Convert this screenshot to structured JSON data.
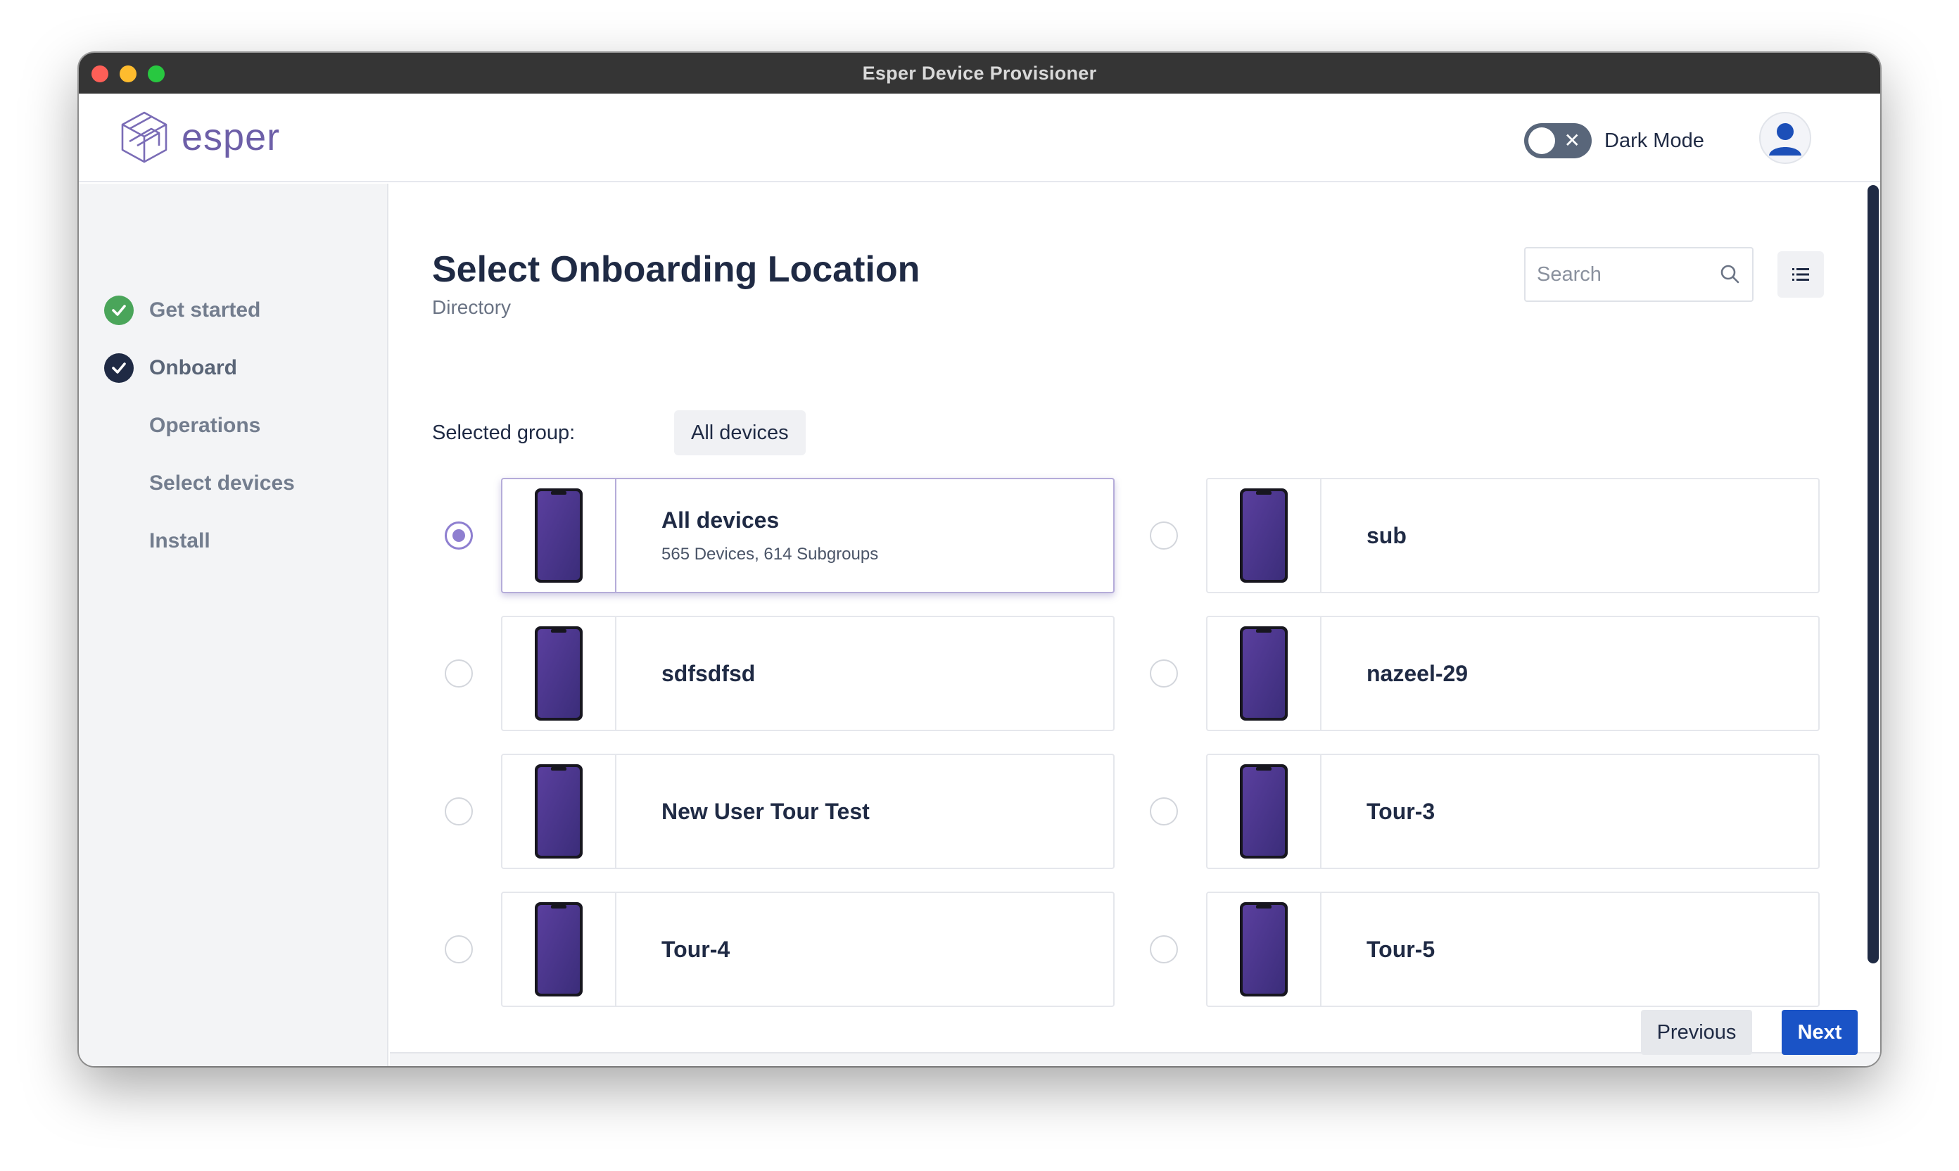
{
  "window": {
    "title": "Esper Device Provisioner"
  },
  "header": {
    "logo_text": "esper",
    "dark_mode_label": "Dark Mode",
    "dark_mode_on": false
  },
  "sidebar": {
    "steps": [
      {
        "label": "Get started",
        "status": "complete"
      },
      {
        "label": "Onboard",
        "status": "current"
      },
      {
        "label": "Operations",
        "status": "pending"
      },
      {
        "label": "Select devices",
        "status": "pending"
      },
      {
        "label": "Install",
        "status": "pending"
      }
    ]
  },
  "main": {
    "title": "Select Onboarding Location",
    "subtitle": "Directory",
    "search_placeholder": "Search",
    "selected_group_label": "Selected group:",
    "selected_group_value": "All devices",
    "groups": [
      {
        "name": "All devices",
        "meta": "565 Devices, 614 Subgroups",
        "selected": true
      },
      {
        "name": "sub",
        "meta": "",
        "selected": false
      },
      {
        "name": "sdfsdfsd",
        "meta": "",
        "selected": false
      },
      {
        "name": "nazeel-29",
        "meta": "",
        "selected": false
      },
      {
        "name": "New User Tour Test",
        "meta": "",
        "selected": false
      },
      {
        "name": "Tour-3",
        "meta": "",
        "selected": false
      },
      {
        "name": "Tour-4",
        "meta": "",
        "selected": false
      },
      {
        "name": "Tour-5",
        "meta": "",
        "selected": false
      }
    ]
  },
  "footer": {
    "previous_label": "Previous",
    "next_label": "Next"
  },
  "colors": {
    "accent": "#1a53c6",
    "radio_selected": "#8e7fd0",
    "step_complete": "#4aa55a",
    "step_current": "#1f2a44",
    "phone": "#4b3a8f"
  },
  "icons": [
    "esper-logo-icon",
    "toggle-x-icon",
    "user-avatar-icon",
    "check-circle-icon",
    "search-icon",
    "list-view-icon",
    "phone-icon"
  ]
}
